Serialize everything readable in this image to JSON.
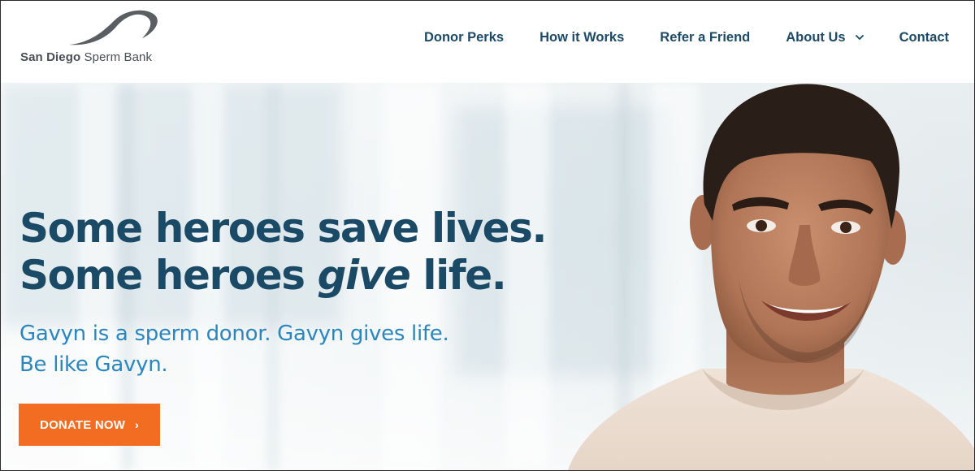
{
  "header": {
    "logo": {
      "name_strong": "San Diego",
      "name_rest": " Sperm Bank"
    },
    "nav": [
      {
        "label": "Donor Perks"
      },
      {
        "label": "How it Works"
      },
      {
        "label": "Refer a Friend"
      },
      {
        "label": "About Us",
        "has_dropdown": true
      },
      {
        "label": "Contact"
      }
    ]
  },
  "hero": {
    "headline_line1": "Some heroes save lives.",
    "headline_line2_pre": "Some heroes ",
    "headline_line2_em": "give",
    "headline_line2_post": " life.",
    "subline1": "Gavyn is a sperm donor. Gavyn gives life.",
    "subline2": "Be like Gavyn.",
    "cta_label": "DONATE NOW",
    "cta_arrow": "›"
  },
  "colors": {
    "nav_text": "#1d4a66",
    "headline": "#1b4a66",
    "subline": "#2b86bd",
    "cta_bg": "#f26d21",
    "logo_swoosh": "#5a5e63"
  },
  "icons": [
    "logo-swoosh-icon",
    "chevron-down-icon",
    "chevron-right-icon"
  ]
}
